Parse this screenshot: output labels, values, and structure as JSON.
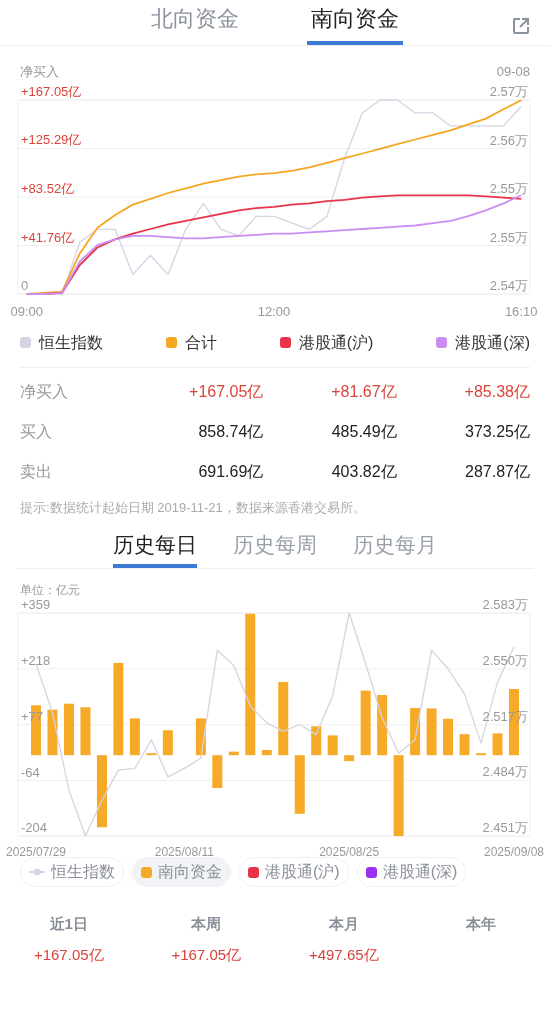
{
  "tabs": [
    {
      "label": "北向资金",
      "selected": false
    },
    {
      "label": "南向资金",
      "selected": true
    }
  ],
  "intraday": {
    "label": "净买入",
    "date": "09-08",
    "chart_data": {
      "type": "line",
      "grid": true,
      "categories": [
        "09:00",
        null,
        null,
        null,
        null,
        null,
        null,
        null,
        null,
        null,
        null,
        null,
        null,
        null,
        "12:00",
        null,
        null,
        null,
        null,
        null,
        null,
        null,
        null,
        null,
        null,
        null,
        null,
        null,
        "16:10"
      ],
      "ylim": [
        0,
        167.05
      ],
      "yticks": [
        {
          "value": 0,
          "label": "0"
        },
        {
          "value": 41.76,
          "label": "+41.76亿"
        },
        {
          "value": 83.52,
          "label": "+83.52亿"
        },
        {
          "value": 125.29,
          "label": "+125.29亿"
        },
        {
          "value": 167.05,
          "label": "+167.05亿"
        }
      ],
      "y2lim": [
        2.54,
        2.57
      ],
      "y2ticks": [
        {
          "value": 2.54,
          "label": "2.54万"
        },
        {
          "value": 2.5475,
          "label": "2.55万"
        },
        {
          "value": 2.555,
          "label": "2.55万"
        },
        {
          "value": 2.5625,
          "label": "2.56万"
        },
        {
          "value": 2.57,
          "label": "2.57万"
        }
      ],
      "series": [
        {
          "name": "恒生指数",
          "color": "#d4d4e2",
          "axis": "y2",
          "values": [
            2.54,
            2.54,
            2.54,
            2.548,
            2.55,
            2.55,
            2.543,
            2.546,
            2.543,
            2.55,
            2.554,
            2.55,
            2.549,
            2.552,
            2.552,
            2.551,
            2.55,
            2.552,
            2.561,
            2.568,
            2.57,
            2.57,
            2.568,
            2.568,
            2.566,
            2.566,
            2.566,
            2.566,
            2.569
          ]
        },
        {
          "name": "合计",
          "color": "#f5a623",
          "values": [
            0,
            1,
            2,
            35,
            57,
            68,
            77,
            82,
            87,
            91,
            95,
            98,
            101,
            103,
            104,
            106,
            109,
            113,
            117,
            121,
            125,
            129,
            133,
            137,
            141,
            146,
            151,
            159,
            167
          ]
        },
        {
          "name": "港股通(沪)",
          "color": "#e8334a",
          "values": [
            0,
            0,
            1,
            25,
            40,
            47,
            52,
            56,
            60,
            63,
            66,
            69,
            72,
            74,
            75,
            77,
            78,
            80,
            81,
            83,
            84,
            85,
            85,
            85,
            85,
            85,
            84,
            83,
            82
          ]
        },
        {
          "name": "港股通(深)",
          "color": "#c98ef0",
          "values": [
            0,
            0,
            1,
            28,
            42,
            47,
            50,
            50,
            49,
            48,
            48,
            49,
            50,
            51,
            52,
            52,
            53,
            54,
            55,
            56,
            57,
            58,
            59,
            61,
            63,
            67,
            72,
            78,
            85
          ]
        }
      ]
    }
  },
  "table": {
    "rows": [
      {
        "label": "净买入",
        "kind": "net",
        "cells": [
          "+167.05亿",
          "+81.67亿",
          "+85.38亿"
        ]
      },
      {
        "label": "买入",
        "kind": "plain",
        "cells": [
          "858.74亿",
          "485.49亿",
          "373.25亿"
        ]
      },
      {
        "label": "卖出",
        "kind": "plain",
        "cells": [
          "691.69亿",
          "403.82亿",
          "287.87亿"
        ]
      }
    ]
  },
  "note": "提示:数据统计起始日期 2019-11-21，数据来源香港交易所。",
  "history_tabs": [
    {
      "label": "历史每日",
      "selected": true
    },
    {
      "label": "历史每周",
      "selected": false
    },
    {
      "label": "历史每月",
      "selected": false
    }
  ],
  "history": {
    "unit": "单位：亿元",
    "chart_data": {
      "type": "bar",
      "grid": true,
      "categories": [
        "2025/07/29",
        null,
        null,
        null,
        null,
        null,
        null,
        null,
        null,
        "2025/08/11",
        null,
        null,
        null,
        null,
        null,
        null,
        null,
        null,
        null,
        "2025/08/25",
        null,
        null,
        null,
        null,
        null,
        null,
        null,
        null,
        null,
        "2025/09/08"
      ],
      "ylim": [
        -204,
        359
      ],
      "yticks": [
        {
          "value": 359,
          "label": "+359"
        },
        {
          "value": 218,
          "label": "+218"
        },
        {
          "value": 77,
          "label": "+77"
        },
        {
          "value": -64,
          "label": "-64"
        },
        {
          "value": -204,
          "label": "-204"
        }
      ],
      "y2lim": [
        2.451,
        2.583
      ],
      "y2ticks": [
        {
          "value": 2.583,
          "label": "2.583万"
        },
        {
          "value": 2.55,
          "label": "2.550万"
        },
        {
          "value": 2.517,
          "label": "2.517万"
        },
        {
          "value": 2.484,
          "label": "2.484万"
        },
        {
          "value": 2.451,
          "label": "2.451万"
        }
      ],
      "series": [
        {
          "name": "恒生指数",
          "color": "#d4d4e2",
          "type": "line",
          "axis": "y2",
          "values": [
            2.553,
            2.524,
            2.478,
            2.451,
            2.472,
            2.49,
            2.491,
            2.508,
            2.486,
            2.491,
            2.497,
            2.561,
            2.552,
            2.528,
            2.518,
            2.513,
            2.517,
            2.511,
            2.534,
            2.583,
            2.553,
            2.521,
            2.5,
            2.508,
            2.561,
            2.55,
            2.535,
            2.506,
            2.542,
            2.563
          ]
        },
        {
          "name": "南向资金",
          "color": "#f7a928",
          "values": [
            126,
            115,
            130,
            121,
            -182,
            233,
            93,
            5,
            63,
            null,
            93,
            -83,
            9,
            357,
            13,
            185,
            -148,
            73,
            50,
            -15,
            163,
            152,
            -204,
            119,
            118,
            92,
            53,
            5,
            55,
            167
          ]
        }
      ]
    },
    "series_legend": [
      {
        "selected": false
      },
      {
        "selected": true
      }
    ],
    "more_legend": [
      {
        "label": "港股通(沪)",
        "color": "#e8334a",
        "selected": false
      },
      {
        "label": "港股通(深)",
        "color": "#9b30f0",
        "selected": false
      }
    ]
  },
  "summary": [
    {
      "label": "近1日",
      "value": "+167.05亿"
    },
    {
      "label": "本周",
      "value": "+167.05亿"
    },
    {
      "label": "本月",
      "value": "+497.65亿"
    },
    {
      "label": "本年"
    }
  ]
}
